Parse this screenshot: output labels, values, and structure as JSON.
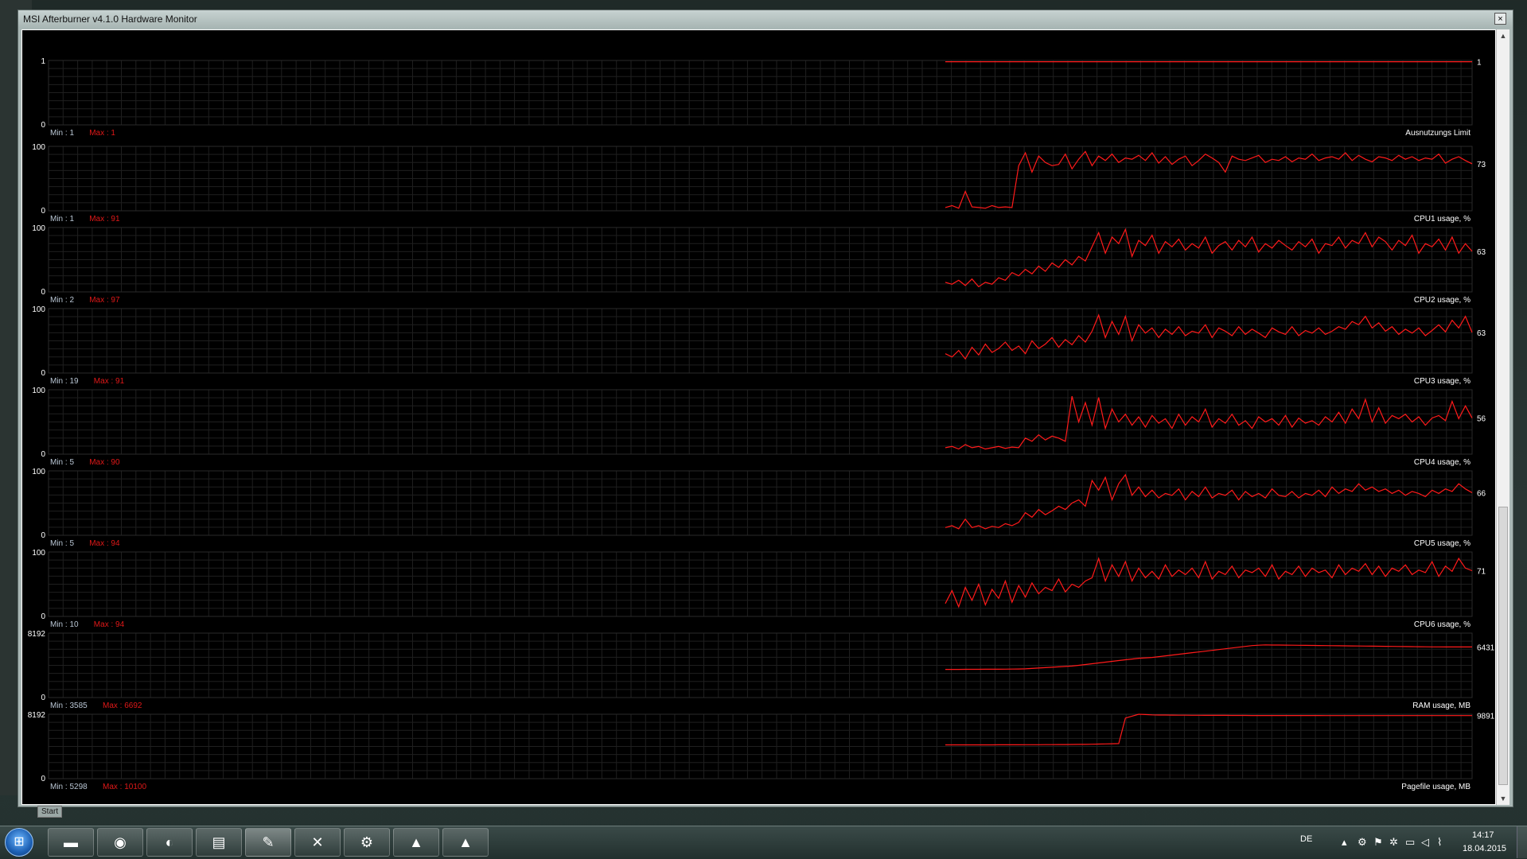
{
  "window": {
    "title": "MSI Afterburner v4.1.0 Hardware Monitor",
    "close_label": "×"
  },
  "start_tab": "Start",
  "graphs": [
    {
      "name": "Ausnutzungs Limit",
      "min": "Min : 1",
      "max": "Max : 1",
      "ytop": "1",
      "ybot": "0",
      "current": "1",
      "ymax": 1,
      "series": [
        0.98,
        0.98,
        0.98,
        0.98,
        0.98,
        0.98,
        0.98,
        0.98,
        0.98,
        0.98,
        0.98,
        0.98,
        0.98,
        0.98,
        0.98,
        0.98,
        0.98,
        0.98,
        0.98,
        0.98
      ]
    },
    {
      "name": "CPU1 usage, %",
      "min": "Min : 1",
      "max": "Max : 91",
      "ytop": "100",
      "ybot": "0",
      "current": "73",
      "ymax": 100,
      "series": [
        5,
        8,
        4,
        30,
        6,
        5,
        4,
        8,
        5,
        6,
        5,
        70,
        90,
        60,
        85,
        75,
        70,
        72,
        88,
        65,
        80,
        92,
        70,
        85,
        78,
        88,
        75,
        82,
        80,
        86,
        78,
        90,
        74,
        84,
        72,
        80,
        85,
        70,
        78,
        88,
        82,
        75,
        60,
        85,
        80,
        78,
        82,
        86,
        75,
        80,
        78,
        84,
        76,
        82,
        80,
        88,
        78,
        82,
        84,
        80,
        90,
        78,
        86,
        80,
        76,
        84,
        82,
        78,
        86,
        80,
        84,
        78,
        82,
        80,
        88,
        74,
        80,
        84,
        78,
        73
      ]
    },
    {
      "name": "CPU2 usage, %",
      "min": "Min : 2",
      "max": "Max : 97",
      "ytop": "100",
      "ybot": "0",
      "current": "63",
      "ymax": 100,
      "series": [
        15,
        12,
        18,
        10,
        20,
        8,
        15,
        12,
        22,
        18,
        30,
        25,
        35,
        28,
        40,
        32,
        45,
        38,
        50,
        42,
        55,
        48,
        70,
        92,
        60,
        85,
        75,
        97,
        55,
        80,
        72,
        88,
        60,
        78,
        70,
        82,
        65,
        75,
        68,
        85,
        60,
        72,
        78,
        65,
        80,
        70,
        85,
        62,
        75,
        68,
        80,
        72,
        65,
        78,
        70,
        82,
        60,
        75,
        72,
        85,
        68,
        80,
        75,
        92,
        70,
        85,
        78,
        65,
        80,
        72,
        88,
        60,
        75,
        70,
        82,
        65,
        85,
        60,
        75,
        63
      ]
    },
    {
      "name": "CPU3 usage, %",
      "min": "Min : 19",
      "max": "Max : 91",
      "ytop": "100",
      "ybot": "0",
      "current": "63",
      "ymax": 100,
      "series": [
        30,
        25,
        35,
        22,
        40,
        28,
        45,
        32,
        38,
        48,
        35,
        42,
        30,
        50,
        38,
        45,
        55,
        40,
        52,
        44,
        58,
        48,
        65,
        90,
        55,
        80,
        60,
        88,
        50,
        75,
        62,
        70,
        55,
        68,
        60,
        72,
        58,
        65,
        62,
        75,
        55,
        70,
        65,
        58,
        72,
        60,
        68,
        62,
        55,
        70,
        64,
        60,
        72,
        58,
        66,
        62,
        70,
        60,
        65,
        72,
        68,
        80,
        75,
        88,
        70,
        78,
        65,
        72,
        60,
        68,
        62,
        70,
        58,
        66,
        75,
        64,
        82,
        70,
        88,
        63
      ]
    },
    {
      "name": "CPU4 usage, %",
      "min": "Min : 5",
      "max": "Max : 90",
      "ytop": "100",
      "ybot": "0",
      "current": "56",
      "ymax": 100,
      "series": [
        10,
        12,
        8,
        15,
        10,
        12,
        8,
        10,
        12,
        9,
        11,
        10,
        25,
        20,
        30,
        22,
        28,
        25,
        20,
        90,
        50,
        80,
        45,
        88,
        40,
        70,
        50,
        62,
        45,
        58,
        42,
        60,
        48,
        55,
        40,
        62,
        45,
        58,
        50,
        70,
        42,
        55,
        48,
        62,
        45,
        52,
        40,
        58,
        50,
        55,
        45,
        60,
        42,
        56,
        48,
        52,
        45,
        58,
        50,
        65,
        48,
        70,
        55,
        85,
        50,
        72,
        48,
        60,
        55,
        62,
        50,
        58,
        45,
        56,
        60,
        52,
        82,
        55,
        75,
        56
      ]
    },
    {
      "name": "CPU5 usage, %",
      "min": "Min : 5",
      "max": "Max : 94",
      "ytop": "100",
      "ybot": "0",
      "current": "66",
      "ymax": 100,
      "series": [
        12,
        15,
        10,
        25,
        12,
        15,
        10,
        14,
        12,
        18,
        15,
        20,
        35,
        28,
        40,
        32,
        38,
        45,
        40,
        50,
        55,
        45,
        85,
        70,
        90,
        55,
        80,
        94,
        62,
        75,
        60,
        70,
        58,
        65,
        62,
        72,
        55,
        68,
        60,
        75,
        58,
        65,
        62,
        70,
        55,
        68,
        60,
        65,
        58,
        72,
        62,
        60,
        68,
        58,
        65,
        62,
        70,
        60,
        75,
        65,
        72,
        68,
        80,
        70,
        75,
        68,
        72,
        65,
        70,
        62,
        68,
        65,
        60,
        70,
        65,
        72,
        68,
        80,
        72,
        66
      ]
    },
    {
      "name": "CPU6 usage, %",
      "min": "Min : 10",
      "max": "Max : 94",
      "ytop": "100",
      "ybot": "0",
      "current": "71",
      "ymax": 100,
      "series": [
        20,
        40,
        15,
        45,
        25,
        50,
        18,
        42,
        28,
        55,
        22,
        48,
        30,
        52,
        35,
        45,
        40,
        58,
        38,
        50,
        45,
        55,
        60,
        90,
        55,
        80,
        62,
        85,
        55,
        75,
        60,
        70,
        58,
        80,
        62,
        72,
        65,
        75,
        60,
        85,
        58,
        70,
        65,
        78,
        60,
        72,
        68,
        75,
        62,
        80,
        58,
        70,
        65,
        78,
        62,
        75,
        68,
        72,
        60,
        80,
        65,
        75,
        70,
        82,
        65,
        78,
        62,
        75,
        70,
        80,
        65,
        72,
        68,
        85,
        62,
        78,
        70,
        90,
        75,
        71
      ]
    },
    {
      "name": "RAM usage, MB",
      "min": "Min : 3585",
      "max": "Max : 6692",
      "ytop": "8192",
      "ybot": "0",
      "current": "6431",
      "ymax": 8192,
      "series": [
        3585,
        3585,
        3585,
        3590,
        3590,
        3595,
        3600,
        3600,
        3600,
        3610,
        3620,
        3630,
        3650,
        3700,
        3750,
        3800,
        3850,
        3900,
        3950,
        4000,
        4100,
        4200,
        4300,
        4400,
        4500,
        4600,
        4700,
        4800,
        4900,
        5000,
        5050,
        5100,
        5200,
        5300,
        5400,
        5500,
        5600,
        5700,
        5800,
        5900,
        6000,
        6100,
        6200,
        6300,
        6400,
        6500,
        6600,
        6650,
        6692,
        6680,
        6670,
        6660,
        6650,
        6640,
        6630,
        6620,
        6610,
        6600,
        6590,
        6580,
        6570,
        6560,
        6550,
        6540,
        6530,
        6520,
        6510,
        6500,
        6490,
        6480,
        6470,
        6460,
        6450,
        6445,
        6440,
        6435,
        6433,
        6432,
        6431,
        6431
      ]
    },
    {
      "name": "Pagefile usage, MB",
      "min": "Min : 5298",
      "max": "Max : 10100",
      "ytop": "8192",
      "ybot": "0",
      "current": "9891",
      "ymax": 10100,
      "series": [
        5298,
        5298,
        5298,
        5300,
        5300,
        5302,
        5305,
        5305,
        5310,
        5310,
        5312,
        5315,
        5320,
        5325,
        5330,
        5335,
        5340,
        5345,
        5350,
        5360,
        5370,
        5380,
        5400,
        5420,
        5450,
        5480,
        5500,
        9500,
        9800,
        10100,
        10050,
        10000,
        9980,
        9970,
        9960,
        9950,
        9950,
        9940,
        9940,
        9930,
        9930,
        9920,
        9920,
        9915,
        9910,
        9910,
        9905,
        9905,
        9900,
        9900,
        9900,
        9898,
        9898,
        9896,
        9896,
        9895,
        9895,
        9894,
        9894,
        9893,
        9893,
        9893,
        9892,
        9892,
        9892,
        9892,
        9891,
        9891,
        9891,
        9891,
        9891,
        9891,
        9891,
        9891,
        9891,
        9891,
        9891,
        9891,
        9891,
        9891
      ]
    }
  ],
  "colors": {
    "line": "#ff1a1a",
    "min_text": "#b9c6d4",
    "max_text": "#e01818",
    "label": "#ffffff",
    "grid": "#1f1f1f"
  },
  "taskbar": {
    "buttons": [
      "folder-icon",
      "chrome-icon",
      "media-player-icon",
      "winrar-icon",
      "afterburner-icon",
      "xbox-icon",
      "steam-icon",
      "arma-icon",
      "arma2-icon"
    ],
    "language": "DE",
    "time": "14:17",
    "date": "18.04.2015"
  }
}
